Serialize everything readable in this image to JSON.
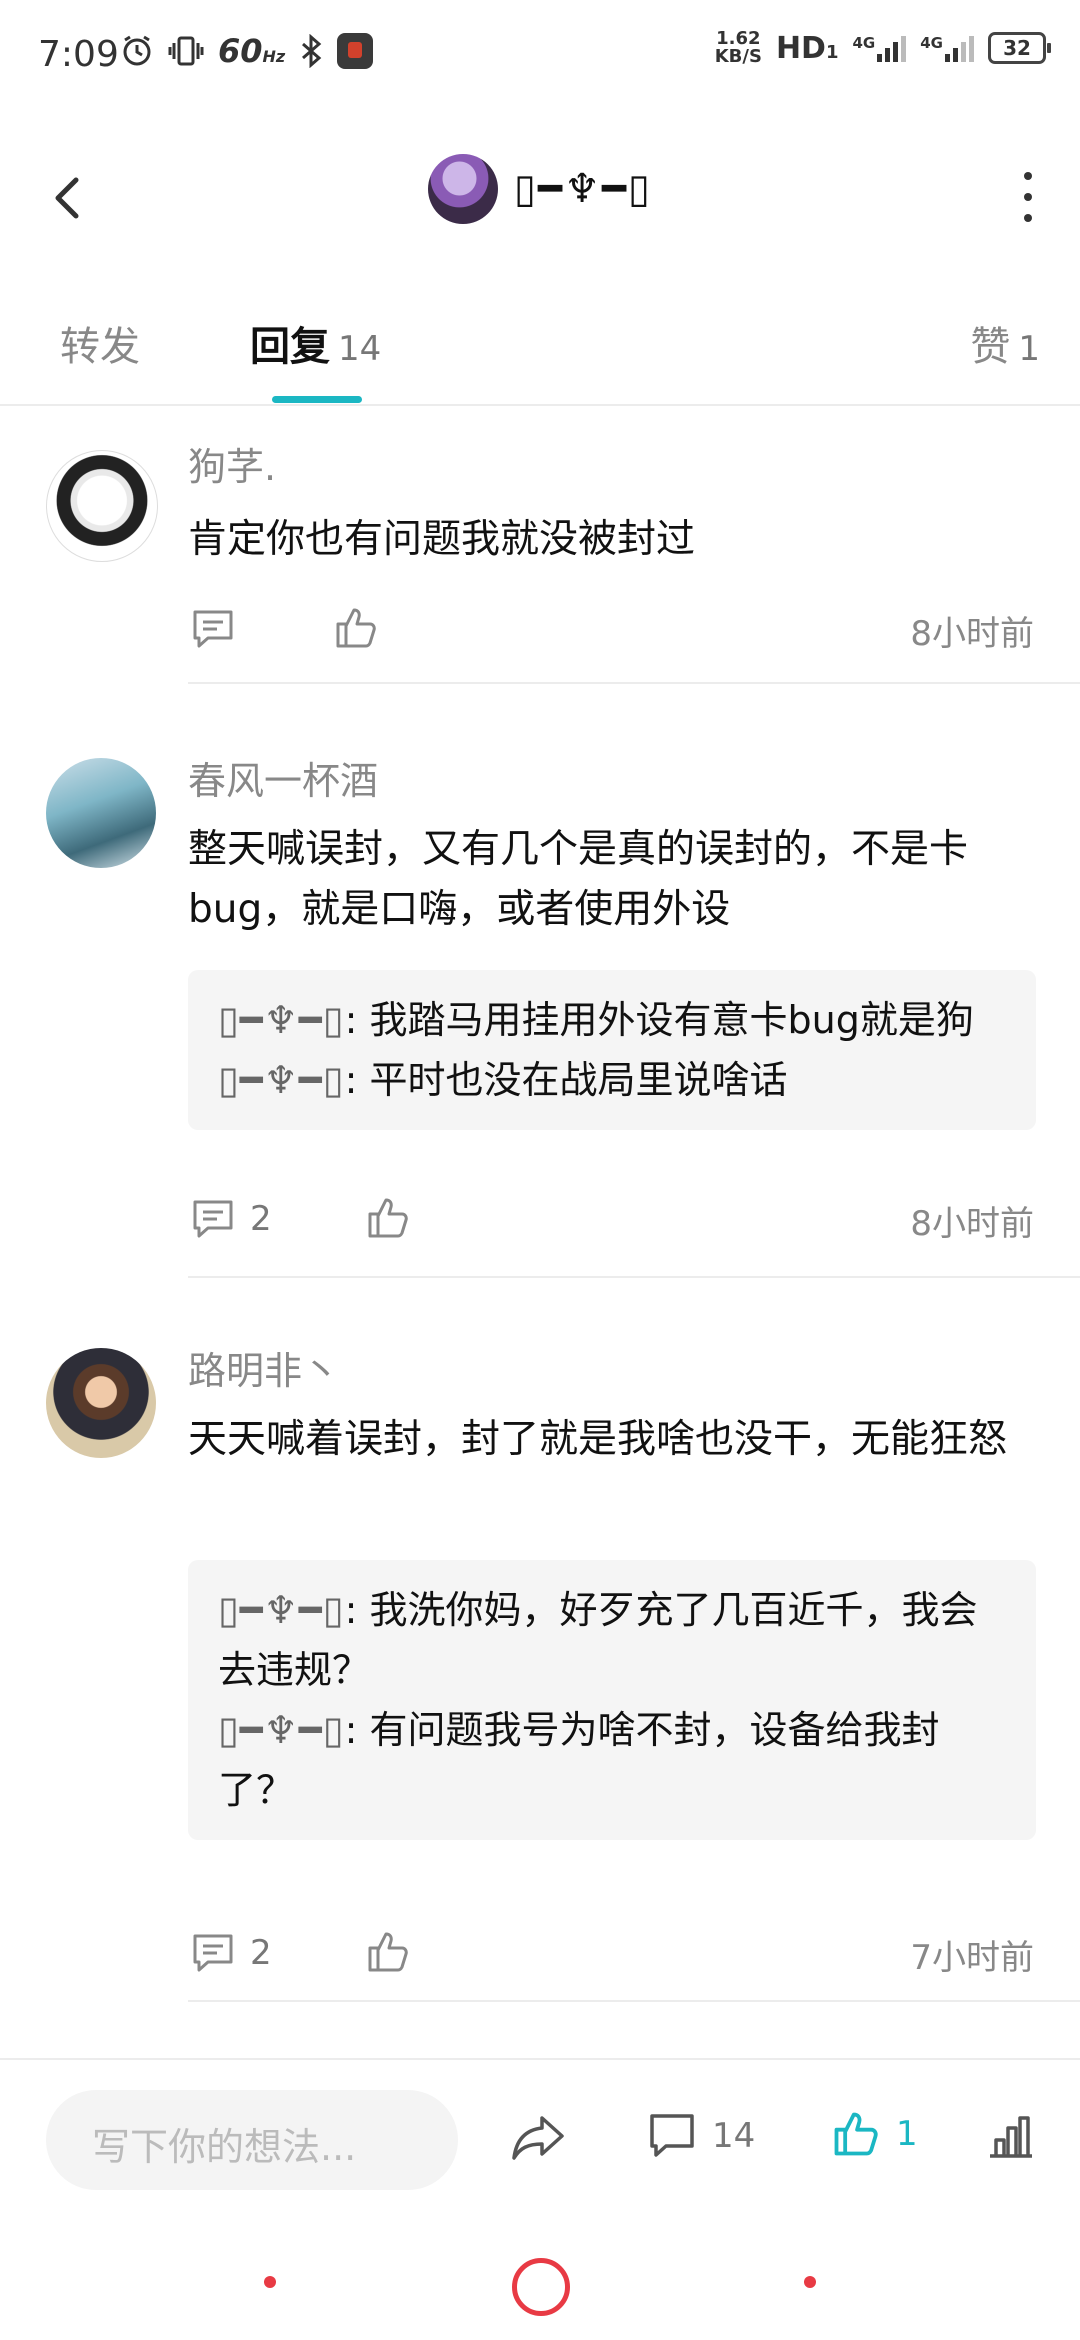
{
  "status": {
    "time": "7:09",
    "refresh": "60",
    "refresh_unit": "Hz",
    "speed_top": "1.62",
    "speed_bottom": "KB/S",
    "hd": "HD",
    "hd_sub": "1",
    "sig1": "4G",
    "sig2": "4G",
    "battery": "32"
  },
  "header": {
    "username": "▯━♆━▯",
    "avatar_icon": "purple-hair-avatar"
  },
  "tabs": {
    "forward": "转发",
    "reply": "回复",
    "reply_count": "14",
    "like": "赞",
    "like_count": "1",
    "accent": "#1bb7c3"
  },
  "comments": [
    {
      "name": "狗芓.",
      "text": "肯定你也有问题我就没被封过",
      "reply_count": "",
      "time": "8小时前",
      "replies": []
    },
    {
      "name": "春风一杯酒",
      "text": "整天喊误封，又有几个是真的误封的，不是卡bug，就是口嗨，或者使用外设",
      "reply_count": "2",
      "time": "8小时前",
      "replies": [
        {
          "name": "▯━♆━▯",
          "text": ": 我踏马用挂用外设有意卡bug就是狗"
        },
        {
          "name": "▯━♆━▯",
          "text": ": 平时也没在战局里说啥话"
        }
      ]
    },
    {
      "name": "路明非丶",
      "text": "天天喊着误封，封了就是我啥也没干，无能狂怒",
      "reply_count": "2",
      "time": "7小时前",
      "replies": [
        {
          "name": "▯━♆━▯",
          "text": ": 我洗你妈，好歹充了几百近千，我会去违规？"
        },
        {
          "name": "▯━♆━▯",
          "text": ": 有问题我号为啥不封，设备给我封了？"
        }
      ]
    }
  ],
  "bottom": {
    "placeholder": "写下你的想法...",
    "comment_count": "14",
    "like_count": "1"
  }
}
